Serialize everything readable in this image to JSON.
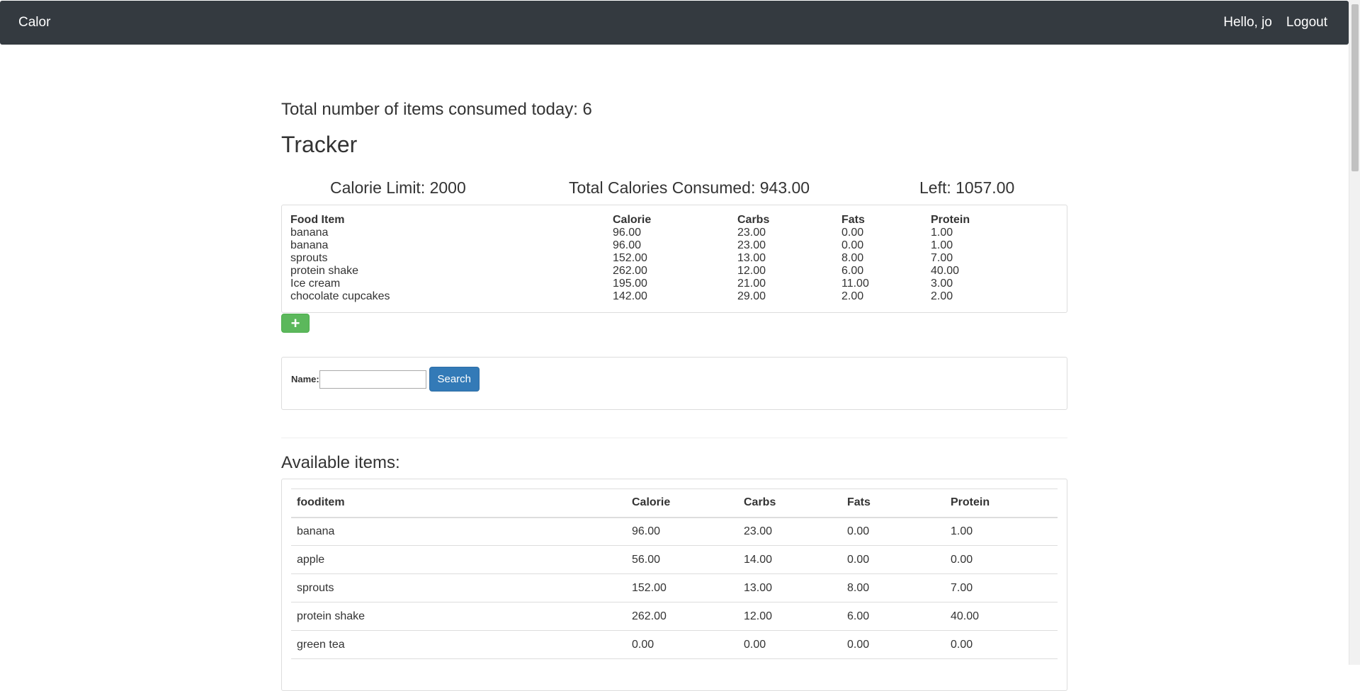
{
  "navbar": {
    "brand": "Calor",
    "greeting": "Hello, jo",
    "logout": "Logout"
  },
  "summary": {
    "items_consumed": "Total number of items consumed today: 6",
    "tracker_title": "Tracker",
    "calorie_limit": "Calorie Limit: 2000",
    "total_consumed": "Total Calories Consumed: 943.00",
    "left": "Left: 1057.00"
  },
  "consumed_table": {
    "headers": [
      "Food Item",
      "Calorie",
      "Carbs",
      "Fats",
      "Protein"
    ],
    "rows": [
      [
        "banana",
        "96.00",
        "23.00",
        "0.00",
        "1.00"
      ],
      [
        "banana",
        "96.00",
        "23.00",
        "0.00",
        "1.00"
      ],
      [
        "sprouts",
        "152.00",
        "13.00",
        "8.00",
        "7.00"
      ],
      [
        "protein shake",
        "262.00",
        "12.00",
        "6.00",
        "40.00"
      ],
      [
        "Ice cream",
        "195.00",
        "21.00",
        "11.00",
        "3.00"
      ],
      [
        "chocolate cupcakes",
        "142.00",
        "29.00",
        "2.00",
        "2.00"
      ]
    ]
  },
  "add_button": "+",
  "search": {
    "label": "Name:",
    "value": "",
    "button": "Search"
  },
  "available": {
    "title": "Available items:",
    "headers": [
      "fooditem",
      "Calorie",
      "Carbs",
      "Fats",
      "Protein"
    ],
    "rows": [
      [
        "banana",
        "96.00",
        "23.00",
        "0.00",
        "1.00"
      ],
      [
        "apple",
        "56.00",
        "14.00",
        "0.00",
        "0.00"
      ],
      [
        "sprouts",
        "152.00",
        "13.00",
        "8.00",
        "7.00"
      ],
      [
        "protein shake",
        "262.00",
        "12.00",
        "6.00",
        "40.00"
      ],
      [
        "green tea",
        "0.00",
        "0.00",
        "0.00",
        "0.00"
      ]
    ]
  },
  "colors": {
    "navbar": "#343a40",
    "add_button": "#5cb85c",
    "search_button": "#337ab7"
  }
}
